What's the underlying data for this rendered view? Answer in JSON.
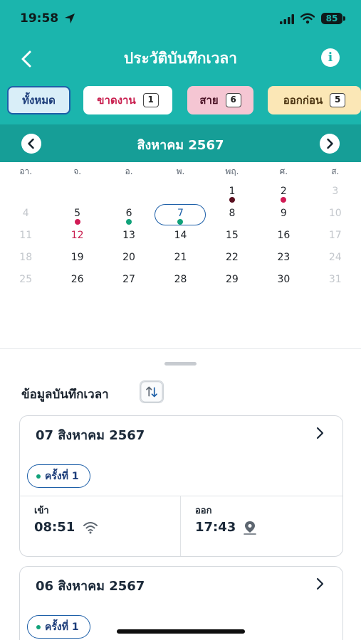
{
  "status_bar": {
    "time": "19:58",
    "battery": "85"
  },
  "header": {
    "title": "ประวัติบันทึกเวลา"
  },
  "filters": {
    "all": {
      "label": "ทั้งหมด"
    },
    "absent": {
      "label": "ขาดงาน",
      "count": "1"
    },
    "late": {
      "label": "สาย",
      "count": "6"
    },
    "early": {
      "label": "ออกก่อน",
      "count": "5"
    }
  },
  "calendar": {
    "month_label": "สิงหาคม 2567",
    "weekdays": [
      "อา.",
      "จ.",
      "อ.",
      "พ.",
      "พฤ.",
      "ศ.",
      "ส."
    ],
    "weeks": [
      [
        {
          "d": "",
          "s": "muted"
        },
        {
          "d": "",
          "s": "muted"
        },
        {
          "d": "",
          "s": "muted"
        },
        {
          "d": "",
          "s": "muted"
        },
        {
          "d": "1",
          "s": "normal",
          "dot": "#5a1020"
        },
        {
          "d": "2",
          "s": "normal",
          "dot": "#d11b55"
        },
        {
          "d": "3",
          "s": "muted"
        }
      ],
      [
        {
          "d": "4",
          "s": "muted"
        },
        {
          "d": "5",
          "s": "normal",
          "dot": "#d11b55"
        },
        {
          "d": "6",
          "s": "normal",
          "dot": "#11a27a"
        },
        {
          "d": "7",
          "s": "selected",
          "dot": "#11a27a"
        },
        {
          "d": "8",
          "s": "normal"
        },
        {
          "d": "9",
          "s": "normal"
        },
        {
          "d": "10",
          "s": "muted"
        }
      ],
      [
        {
          "d": "11",
          "s": "muted"
        },
        {
          "d": "12",
          "s": "holiday"
        },
        {
          "d": "13",
          "s": "normal"
        },
        {
          "d": "14",
          "s": "normal"
        },
        {
          "d": "15",
          "s": "normal"
        },
        {
          "d": "16",
          "s": "normal"
        },
        {
          "d": "17",
          "s": "muted"
        }
      ],
      [
        {
          "d": "18",
          "s": "muted"
        },
        {
          "d": "19",
          "s": "normal"
        },
        {
          "d": "20",
          "s": "normal"
        },
        {
          "d": "21",
          "s": "normal"
        },
        {
          "d": "22",
          "s": "normal"
        },
        {
          "d": "23",
          "s": "normal"
        },
        {
          "d": "24",
          "s": "muted"
        }
      ],
      [
        {
          "d": "25",
          "s": "muted"
        },
        {
          "d": "26",
          "s": "normal"
        },
        {
          "d": "27",
          "s": "normal"
        },
        {
          "d": "28",
          "s": "normal"
        },
        {
          "d": "29",
          "s": "normal"
        },
        {
          "d": "30",
          "s": "normal"
        },
        {
          "d": "31",
          "s": "muted"
        }
      ]
    ]
  },
  "sheet": {
    "title": "ข้อมูลบันทึกเวลา",
    "records": [
      {
        "date": "07 สิงหาคม 2567",
        "round": "ครั้งที่ 1",
        "in_label": "เข้า",
        "in_time": "08:51",
        "in_icon": "wifi-icon",
        "out_label": "ออก",
        "out_time": "17:43",
        "out_icon": "location-pin-icon"
      },
      {
        "date": "06 สิงหาคม 2567",
        "round": "ครั้งที่ 1"
      }
    ]
  },
  "colors": {
    "primary": "#1bb5ad",
    "month_bar": "#169e97",
    "accent_blue": "#1d5fa8",
    "dot_green": "#11a27a",
    "dot_red": "#d11b55"
  }
}
